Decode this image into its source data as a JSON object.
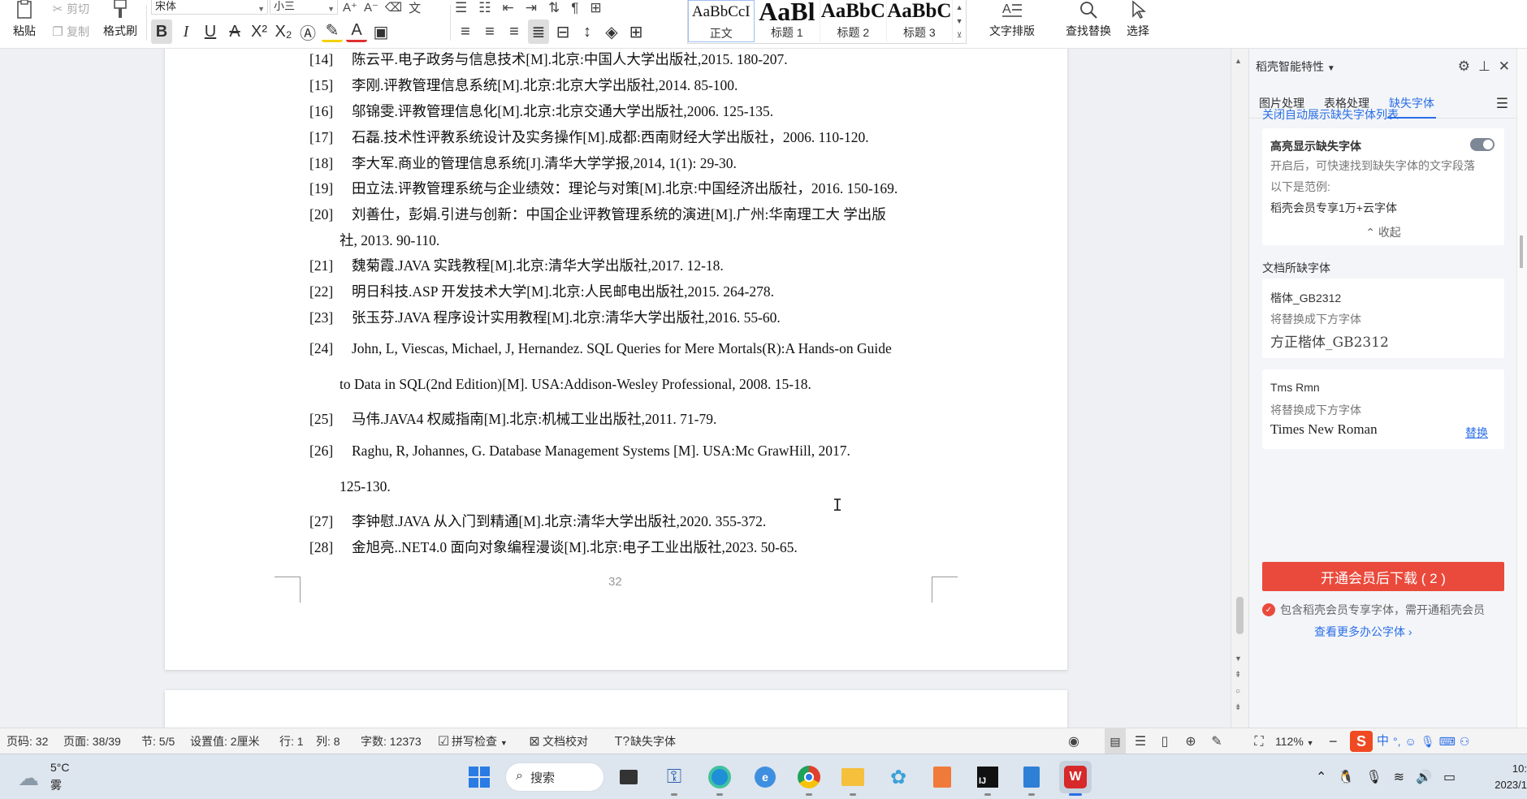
{
  "ribbon": {
    "paste_label": "粘贴",
    "cut_label": "剪切",
    "copy_label": "复制",
    "format_painter_label": "格式刷",
    "font_name": "宋体",
    "font_size": "小三",
    "styles": [
      {
        "preview": "AaBbCcI",
        "label": "正文"
      },
      {
        "preview": "AaBl",
        "label": "标题 1"
      },
      {
        "preview": "AaBbC",
        "label": "标题 2"
      },
      {
        "preview": "AaBbC",
        "label": "标题 3"
      }
    ],
    "text_layout_label": "文字排版",
    "find_replace_label": "查找替换",
    "select_label": "选择"
  },
  "document": {
    "references": [
      {
        "num": "[14]",
        "text": "陈云平.电子政务与信息技术[M].北京:中国人大学出版社,2015. 180-207."
      },
      {
        "num": "[15]",
        "text": "李刚.评教管理信息系统[M].北京:北京大学出版社,2014. 85-100."
      },
      {
        "num": "[16]",
        "text": "邬锦雯.评教管理信息化[M].北京:北京交通大学出版社,2006. 125-135."
      },
      {
        "num": "[17]",
        "text": "石磊.技术性评教系统设计及实务操作[M].成都:西南财经大学出版社，2006. 110-120."
      },
      {
        "num": "[18]",
        "text": "李大军.商业的管理信息系统[J].清华大学学报,2014, 1(1): 29-30."
      },
      {
        "num": "[19]",
        "text": "田立法.评教管理系统与企业绩效：理论与对策[M].北京:中国经济出版社，2016. 150-169."
      },
      {
        "num": "[20]",
        "text": "刘善仕，彭娟.引进与创新：中国企业评教管理系统的演进[M].广州:华南理工大  学出版"
      },
      {
        "num": "",
        "text": "社, 2013. 90-110."
      },
      {
        "num": "[21]",
        "text": "魏菊霞.JAVA 实践教程[M].北京:清华大学出版社,2017. 12-18."
      },
      {
        "num": "[22]",
        "text": "明日科技.ASP 开发技术大学[M].北京:人民邮电出版社,2015. 264-278."
      },
      {
        "num": "[23]",
        "text": "张玉芬.JAVA 程序设计实用教程[M].北京:清华大学出版社,2016. 55-60."
      },
      {
        "num": "[24]",
        "text": "John, L, Viescas, Michael, J, Hernandez. SQL Queries for Mere Mortals(R):A Hands-on Guide"
      },
      {
        "num": "",
        "text": "to Data in SQL(2nd Edition)[M]. USA:Addison-Wesley Professional, 2008. 15-18."
      },
      {
        "num": "[25]",
        "text": "马伟.JAVA4 权威指南[M].北京:机械工业出版社,2011. 71-79."
      },
      {
        "num": "[26]",
        "text": "Raghu, R, Johannes, G. Database Management Systems [M]. USA:Mc GrawHill, 2017."
      },
      {
        "num": "",
        "text": "125-130."
      },
      {
        "num": "[27]",
        "text": "李钟慰.JAVA 从入门到精通[M].北京:清华大学出版社,2020. 355-372."
      },
      {
        "num": "[28]",
        "text": "金旭亮..NET4.0 面向对象编程漫谈[M].北京:电子工业出版社,2023. 50-65."
      }
    ],
    "page_number": "32"
  },
  "side_panel": {
    "title": "稻壳智能特性",
    "tabs": [
      "图片处理",
      "表格处理",
      "缺失字体"
    ],
    "close_auto_link": "关闭自动展示缺失字体列表",
    "highlight_title": "高亮显示缺失字体",
    "highlight_desc": "开启后，可快速找到缺失字体的文字段落",
    "example_label": "以下是范例:",
    "example_text": "稻壳会员专享1万+云字体",
    "collapse_label": "收起",
    "missing_fonts_heading": "文档所缺字体",
    "fonts": [
      {
        "name": "楷体_GB2312",
        "replace_hint": "将替换成下方字体",
        "replacement": "方正楷体_GB2312",
        "action": ""
      },
      {
        "name": "Tms Rmn",
        "replace_hint": "将替换成下方字体",
        "replacement": "Times New Roman",
        "action": "替换"
      }
    ],
    "download_button": "开通会员后下载 ( 2 )",
    "member_hint": "包含稻壳会员专享字体，需开通稻壳会员",
    "more_fonts_link": "查看更多办公字体"
  },
  "statusbar": {
    "page_code": "页码: 32",
    "page": "页面: 38/39",
    "section": "节: 5/5",
    "setting": "设置值: 2厘米",
    "row": "行: 1",
    "col": "列: 8",
    "word_count": "字数: 12373",
    "spell_check": "拼写检查",
    "doc_proof": "文档校对",
    "missing_font": "缺失字体",
    "zoom": "112%"
  },
  "taskbar": {
    "weather_temp": "5°C",
    "weather_desc": "雾",
    "search_label": "搜索",
    "ime_label": "中",
    "clock_time": "10:",
    "clock_date": "2023/1"
  },
  "colors": {
    "accent": "#2a6ee8",
    "download_button": "#ea4a3c",
    "wps_red": "#d7282a"
  }
}
